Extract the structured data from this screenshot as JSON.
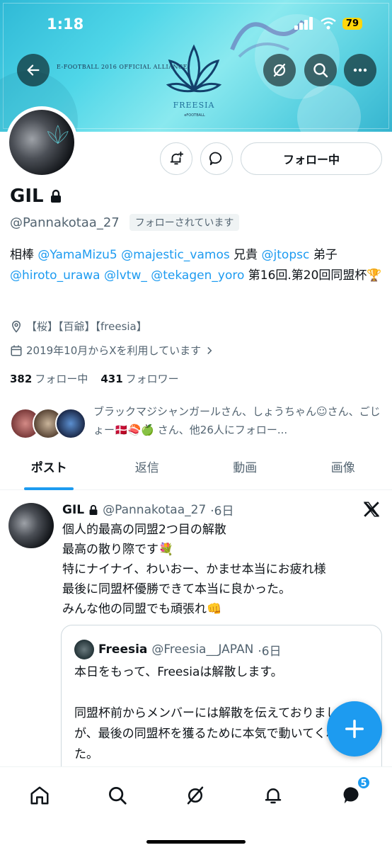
{
  "status_bar": {
    "time": "1:18",
    "battery": "79"
  },
  "banner": {
    "alliance_text": "E-FOOTBALL 2016 OFFICIAL ALLIANCE",
    "brand_text": "FREESIA",
    "sub_text": "eFOOTBALL"
  },
  "profile": {
    "name": "GIL",
    "handle": "@Pannakotaa_27",
    "follows_you": "フォロー​されています",
    "follow_button": "フォロー中",
    "bio": {
      "p1": "相棒 ",
      "m1": "@YamaMizu5",
      "p2": " ",
      "m2": "@majestic_vamos",
      "p3": " 兄貴 ",
      "m3": "@jtopsc",
      "p4": " 弟子 ",
      "m4": "@hiroto_urawa",
      "p5": " ",
      "m5": "@lvtw_",
      "p6": " ",
      "m6": "@tekagen_yoro",
      "p7": " 第16回.第20回同盟杯🏆"
    },
    "location": "【桜】【百爺】【freesia】",
    "joined": "2019年10月からXを利用しています",
    "following_count": "382",
    "following_label": "フォロー中",
    "followers_count": "431",
    "followers_label": "フォロワー",
    "known_followers": "ブラックマジシャンガールさん、しょうちゃん☺︎さん、ごじょー🇩🇰🍣🍏 さん、他26人にフォロー..."
  },
  "tabs": [
    {
      "label": "ポスト"
    },
    {
      "label": "返信"
    },
    {
      "label": "動画"
    },
    {
      "label": "画像"
    }
  ],
  "post": {
    "name": "GIL",
    "handle": "@Pannakotaa_27",
    "time": "·6日",
    "lines": [
      "個人的最高の同盟2つ目の解散",
      "最高の散り際です💐",
      "特にナイナイ、わいおー、かませ本当にお疲れ様",
      "最後に同盟杯優勝できて本当に良かった。",
      "みんな他の同盟でも頑張れ👊"
    ],
    "quote": {
      "name": "Freesia",
      "handle": "@Freesia__JAPAN",
      "time": "·6日",
      "text": "本日をもって、Freesiaは解散します。\n\n同盟杯前からメンバーには解散を伝えておりましたが、最後の同盟杯を獲るために本気で動いてくれました。\nみんな本当にありがとう"
    }
  },
  "nav": {
    "messages_badge": "5"
  },
  "colors": {
    "accent": "#1d9bf0",
    "text": "#0f1419",
    "muted": "#536471"
  }
}
